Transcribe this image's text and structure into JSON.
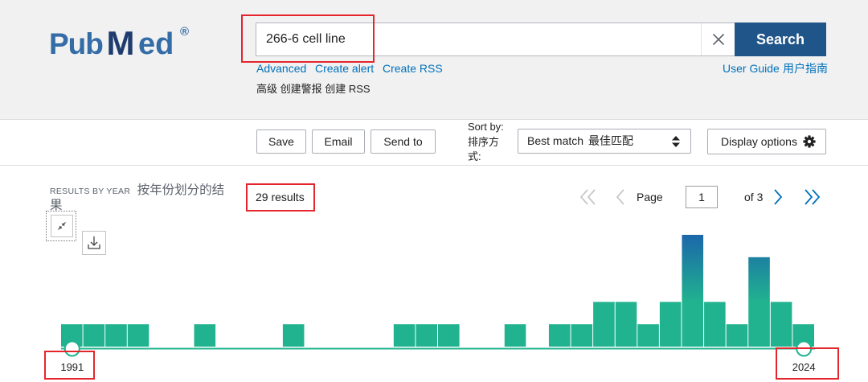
{
  "logo": {
    "pub": "Pub",
    "m": "M",
    "ed": "ed",
    "reg": "®"
  },
  "search": {
    "query": "266-6 cell line",
    "button_label": "Search"
  },
  "header_links": {
    "advanced": "Advanced",
    "create_alert": "Create alert",
    "create_rss": "Create RSS",
    "translation": "高级 创建警报 创建 RSS",
    "user_guide": "User Guide",
    "user_guide_zh": "用户指南"
  },
  "toolbar": {
    "save": "Save",
    "email": "Email",
    "send_to": "Send to",
    "sort_label": "Sort by:",
    "sort_label_zh": "排序方式:",
    "sort_value": "Best match",
    "sort_value_zh": "最佳匹配",
    "display_options": "Display options"
  },
  "results": {
    "count_label": "29 results"
  },
  "pagination": {
    "page_label": "Page",
    "page_value": "1",
    "of_label": "of 3"
  },
  "icons": {
    "clear": "close-icon",
    "sort": "sort-arrows-icon",
    "display_options": "gear-icon",
    "first_page": "double-chevron-left-icon",
    "prev_page": "chevron-left-icon",
    "next_page": "chevron-right-icon",
    "last_page": "double-chevron-right-icon",
    "collapse_chart": "collapse-icon",
    "download_chart": "download-icon"
  },
  "colors": {
    "search_button": "#20558a",
    "link": "#0071bc",
    "header_bg": "#f1f1f1",
    "bar": "#21b38f",
    "bar_top": "#1b67aa",
    "baseline": "#21b38f",
    "annotation": "#e3262c",
    "disabled_chevron": "#c8c8c8"
  },
  "chart_data": {
    "type": "bar",
    "title": "RESULTS BY YEAR",
    "title_zh": "按年份划分的结果",
    "x": [
      1991,
      1992,
      1993,
      1994,
      1995,
      1996,
      1997,
      1998,
      1999,
      2000,
      2001,
      2002,
      2003,
      2004,
      2005,
      2006,
      2007,
      2008,
      2009,
      2010,
      2011,
      2012,
      2013,
      2014,
      2015,
      2016,
      2017,
      2018,
      2019,
      2020,
      2021,
      2022,
      2023,
      2024
    ],
    "values": [
      1,
      1,
      1,
      1,
      0,
      0,
      1,
      0,
      0,
      0,
      1,
      0,
      0,
      0,
      0,
      1,
      1,
      1,
      0,
      0,
      1,
      0,
      1,
      1,
      2,
      2,
      1,
      2,
      5,
      2,
      1,
      4,
      2,
      1
    ],
    "ylim": [
      0,
      5
    ],
    "range": {
      "start": 1991,
      "end": 2024
    },
    "grid": false,
    "legend": "none"
  }
}
